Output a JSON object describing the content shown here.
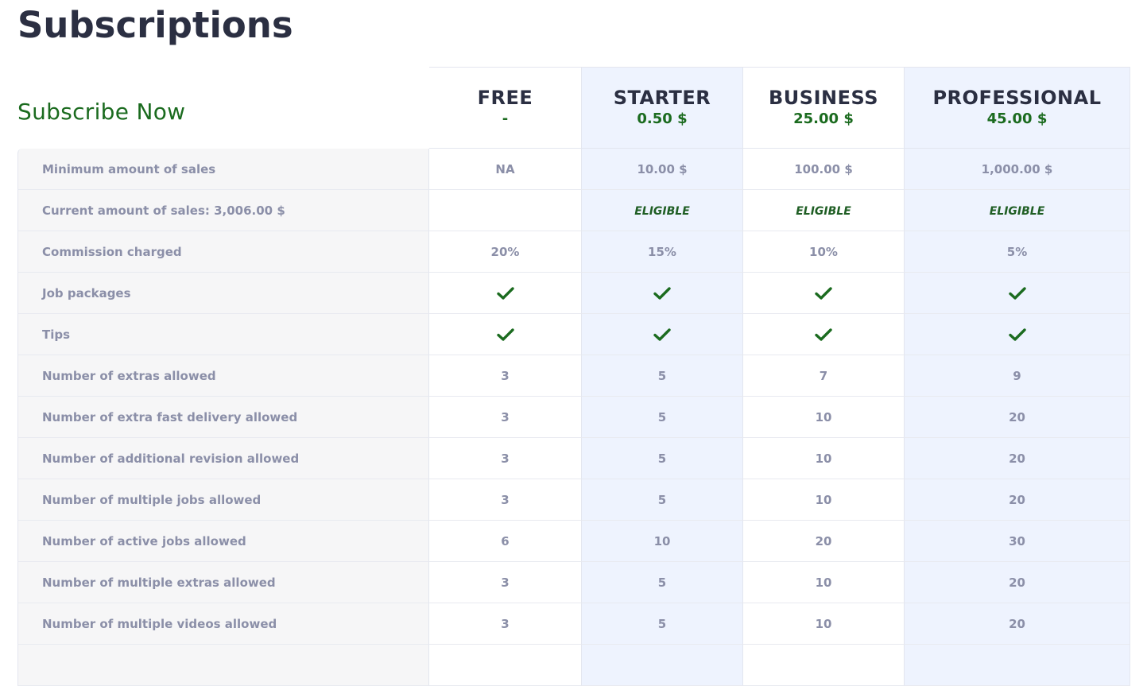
{
  "page": {
    "title": "Subscriptions"
  },
  "pricing": {
    "subscribe_label": "Subscribe Now",
    "plans": [
      {
        "name": "FREE",
        "price": "-"
      },
      {
        "name": "STARTER",
        "price": "0.50 $"
      },
      {
        "name": "BUSINESS",
        "price": "25.00 $"
      },
      {
        "name": "PROFESSIONAL",
        "price": "45.00 $"
      }
    ],
    "rows": [
      {
        "label": "Minimum amount of sales",
        "values": [
          "NA",
          "10.00 $",
          "100.00 $",
          "1,000.00 $"
        ]
      },
      {
        "label": "Current amount of sales: 3,006.00 $",
        "values": [
          "",
          "ELIGIBLE",
          "ELIGIBLE",
          "ELIGIBLE"
        ]
      },
      {
        "label": "Commission charged",
        "values": [
          "20%",
          "15%",
          "10%",
          "5%"
        ]
      },
      {
        "label": "Job packages",
        "values": [
          "check",
          "check",
          "check",
          "check"
        ]
      },
      {
        "label": "Tips",
        "values": [
          "check",
          "check",
          "check",
          "check"
        ]
      },
      {
        "label": "Number of extras allowed",
        "values": [
          "3",
          "5",
          "7",
          "9"
        ]
      },
      {
        "label": "Number of extra fast delivery allowed",
        "values": [
          "3",
          "5",
          "10",
          "20"
        ]
      },
      {
        "label": "Number of additional revision allowed",
        "values": [
          "3",
          "5",
          "10",
          "20"
        ]
      },
      {
        "label": "Number of multiple jobs allowed",
        "values": [
          "3",
          "5",
          "10",
          "20"
        ]
      },
      {
        "label": "Number of active jobs allowed",
        "values": [
          "6",
          "10",
          "20",
          "30"
        ]
      },
      {
        "label": "Number of multiple extras allowed",
        "values": [
          "3",
          "5",
          "10",
          "20"
        ]
      },
      {
        "label": "Number of multiple videos allowed",
        "values": [
          "3",
          "5",
          "10",
          "20"
        ]
      },
      {
        "label": "",
        "values": [
          "",
          "",
          "",
          ""
        ]
      }
    ]
  },
  "colors": {
    "title": "#2b2f42",
    "accent_green": "#1b6b1f",
    "muted_text": "#8b8fa8",
    "label_bg": "#f6f6f7",
    "highlight_col_bg": "#eef3fe",
    "border": "#e3e6ef"
  },
  "icons": {
    "included": "check-icon"
  }
}
